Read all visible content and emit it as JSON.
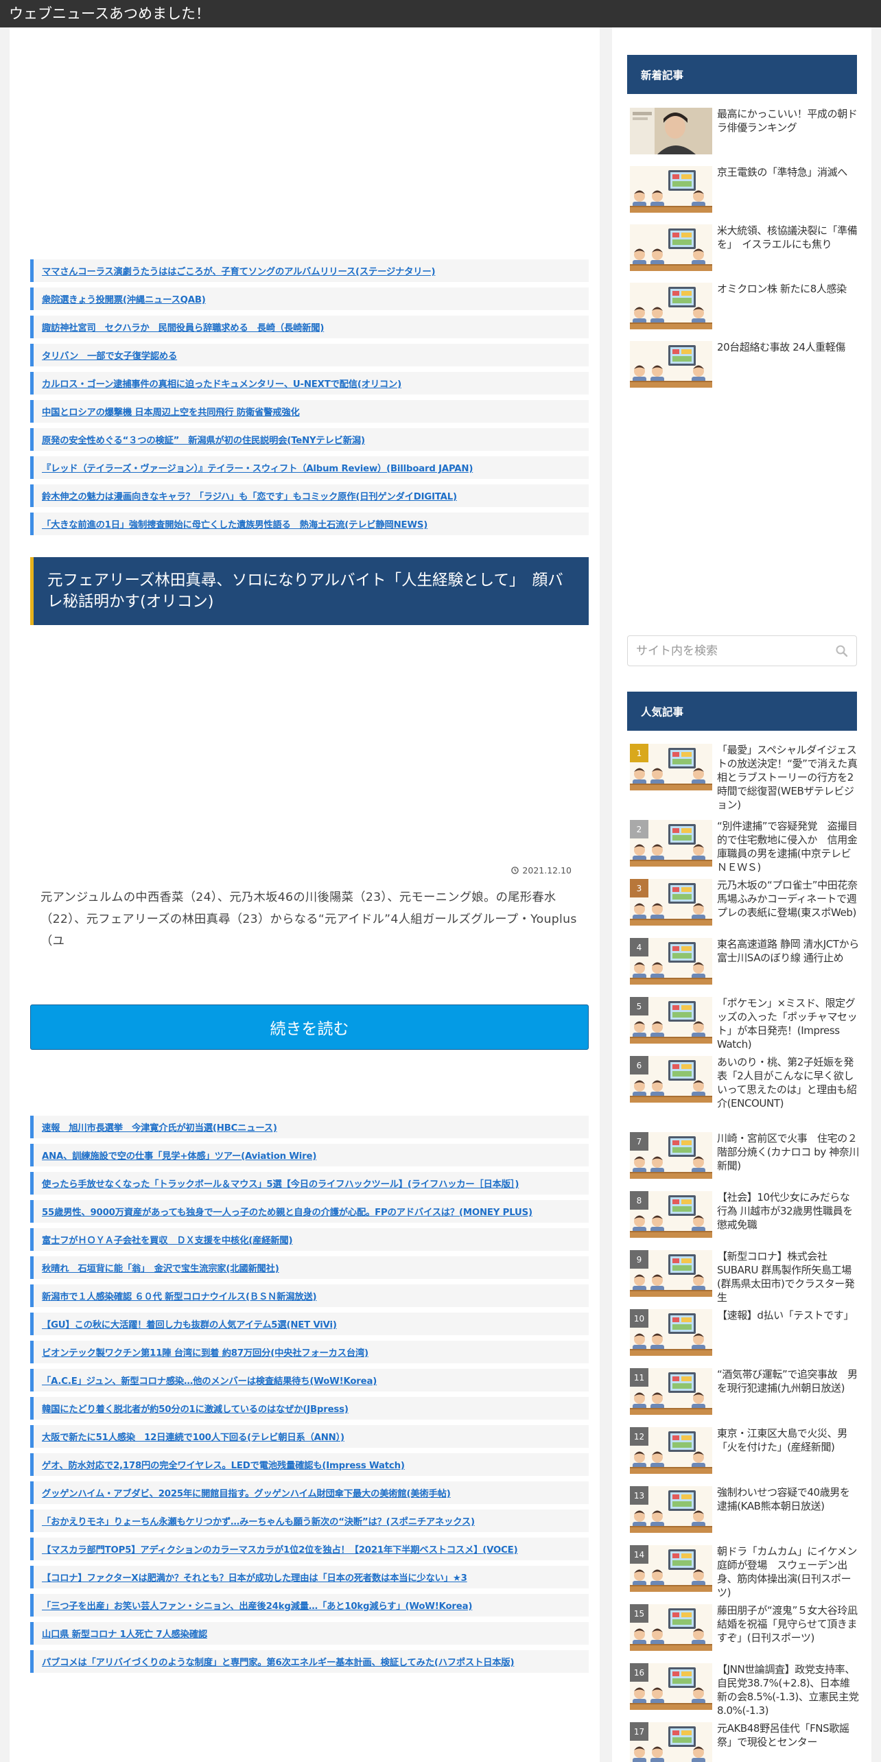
{
  "site": {
    "title": "ウェブニュースあつめました！"
  },
  "top_links": [
    "ママさんコーラス演劇うたうははごころが、子育てソングのアルバムリリース(ステージナタリー)",
    "衆院選きょう投開票(沖縄ニュースQAB)",
    "諏訪神社宮司　セクハラか　民間役員ら辞職求める　長崎（長崎新聞)",
    "タリバン　一部で女子復学認める",
    "カルロス・ゴーン逮捕事件の真相に迫ったドキュメンタリー、U-NEXTで配信(オリコン)",
    "中国とロシアの爆撃機 日本周辺上空を共同飛行 防衛省警戒強化",
    "原発の安全性めぐる“３つの検証”　新潟県が初の住民説明会(TeNYテレビ新潟)",
    "『レッド（テイラーズ・ヴァージョン）』テイラー・スウィフト（Album Review）(Billboard JAPAN)",
    "鈴木伸之の魅力は漫画向きなキャラ？「ラジハ」も「恋です」もコミック原作(日刊ゲンダイDIGITAL)",
    "「大きな前進の1日」強制捜査開始に母亡くした遺族男性語る　熱海土石流(テレビ静岡NEWS)"
  ],
  "article": {
    "title": "元フェアリーズ林田真尋、ソロになりアルバイト「人生経験として」　顔バレ秘話明かす(オリコン)",
    "date": "2021.12.10",
    "excerpt": "元アンジュルムの中西香菜（24）、元乃木坂46の川後陽菜（23）、元モーニング娘。の尾形春水（22）、元フェアリーズの林田真尋（23）からなる“元アイドル”4人組ガールズグループ・Youplus（ユ",
    "read_more": "続きを読む"
  },
  "bottom_links": [
    "速報　旭川市長選挙　今津寛介氏が初当選(HBCニュース)",
    "ANA、訓練施設で空の仕事「見学+体感」ツアー(Aviation Wire)",
    "使ったら手放せなくなった「トラックボール＆マウス」5選【今日のライフハックツール】(ライフハッカー［日本版］)",
    "55歳男性、9000万資産があっても独身で一人っ子のため親と自身の介護が心配。FPのアドバイスは？(MONEY PLUS)",
    "富士フがＨＯＹＡ子会社を買収　ＤＸ支援を中核化(産経新聞)",
    "秋晴れ　石垣背に能「翁」　金沢で宝生流宗家(北國新聞社)",
    "新潟市で１人感染確認 ６０代 新型コロナウイルス(ＢＳＮ新潟放送)",
    "【GU】この秋に大活躍！着回し力も抜群の人気アイテム5選(NET ViVi)",
    "ビオンテック製ワクチン第11陣 台湾に到着 約87万回分(中央社フォーカス台湾)",
    "「A.C.E」ジュン、新型コロナ感染…他のメンバーは検査結果待ち(WoW!Korea)",
    "韓国にたどり着く脱北者が約50分の1に激減しているのはなぜか(JBpress)",
    "大阪で新たに51人感染　12日連続で100人下回る(テレビ朝日系（ANN）)",
    "ゲオ、防水対応で2,178円の完全ワイヤレス。LEDで電池残量確認も(Impress Watch)",
    "グッゲンハイム・アブダビ、2025年に開館目指す。グッゲンハイム財団傘下最大の美術館(美術手帖)",
    "「おかえりモネ」りょーちん永瀬もケリつかず…みーちゃんも願う新次の“決断”は？(スポニチアネックス)",
    "【マスカラ部門TOP5】アディクションのカラーマスカラが1位2位を独占！【2021年下半期ベストコスメ】(VOCE)",
    "【コロナ】ファクターXは肥満か？それとも？日本が成功した理由は「日本の死者数は本当に少ない」★3",
    "「三つ子を出産」お笑い芸人ファン・シニョン、出産後24kg減量…「あと10kg減らす」(WoW!Korea)",
    "山口県 新型コロナ 1人死亡 7人感染確認",
    "パブコメは「アリバイづくりのような制度」と専門家。第6次エネルギー基本計画、検証してみた(ハフポスト日本版)"
  ],
  "sidebar": {
    "new_heading": "新着記事",
    "new_articles": [
      "最高にかっこいい！平成の朝ドラ俳優ランキング",
      "京王電鉄の「準特急」消滅へ",
      "米大統領、核協議決裂に「準備を」　イスラエルにも焦り",
      "オミクロン株 新たに8人感染",
      "20台超絡む事故 24人重軽傷"
    ],
    "search_placeholder": "サイト内を検索",
    "popular_heading": "人気記事",
    "popular": [
      {
        "rank": "1",
        "title": "「最愛」スペシャルダイジェストの放送決定！“愛”で消えた真相とラブストーリーの行方を2時間で総復習(WEBザテレビジョン)"
      },
      {
        "rank": "2",
        "title": "“別件逮捕”で容疑発覚　盗撮目的で住宅敷地に侵入か　信用金庫職員の男を逮捕(中京テレビＮＥＷＳ)"
      },
      {
        "rank": "3",
        "title": "元乃木坂の“プロ雀士”中田花奈　馬場ふみかコーディネートで週プレの表紙に登場(東スポWeb)"
      },
      {
        "rank": "4",
        "title": "東名高速道路 静岡 清水JCTから富士川SAのぼり線 通行止め"
      },
      {
        "rank": "5",
        "title": "「ポケモン」×ミスド、限定グッズの入った「ポッチャマセット」が本日発売！(Impress Watch)"
      },
      {
        "rank": "6",
        "title": "あいのり・桃、第2子妊娠を発表「2人目がこんなに早く欲しいって思えたのは」と理由も紹介(ENCOUNT)"
      },
      {
        "rank": "7",
        "title": "川崎・宮前区で火事　住宅の２階部分焼く(カナロコ by 神奈川新聞)"
      },
      {
        "rank": "8",
        "title": "【社会】10代少女にみだらな行為 川越市が32歳男性職員を懲戒免職"
      },
      {
        "rank": "9",
        "title": "【新型コロナ】株式会社SUBARU 群馬製作所矢島工場(群馬県太田市)でクラスター発生"
      },
      {
        "rank": "10",
        "title": "【速報】d払い「テストです」"
      },
      {
        "rank": "11",
        "title": "“酒気帯び運転”で追突事故　男を現行犯逮捕(九州朝日放送)"
      },
      {
        "rank": "12",
        "title": "東京・江東区大島で火災、男「火を付けた」(産経新聞)"
      },
      {
        "rank": "13",
        "title": "強制わいせつ容疑で40歳男を逮捕(KAB熊本朝日放送)"
      },
      {
        "rank": "14",
        "title": "朝ドラ「カムカム」にイケメン庭師が登場　スウェーデン出身、筋肉体操出演(日刊スポーツ)"
      },
      {
        "rank": "15",
        "title": "藤田朋子が“渡鬼”５女大谷玲凪結婚を祝福「見守らせて頂きますぞ」(日刊スポーツ)"
      },
      {
        "rank": "16",
        "title": "【JNN世論調査】政党支持率、自民党38.7%(+2.8)、日本維新の会8.5%(-1.3)、立憲民主党8.0%(-1.3)"
      },
      {
        "rank": "17",
        "title": "元AKB48野呂佳代「FNS歌謡祭」で現役とセンター"
      }
    ]
  },
  "colors": {
    "topbar": "#333333",
    "heading_blue": "#214978",
    "link_blue": "#1e6fc8",
    "accent_bar": "#3d8de6",
    "title_accent": "#e7b21c",
    "button_blue": "#049be5",
    "rank_gold": "#d9a81c",
    "rank_silver": "#a9a9a9",
    "rank_bronze": "#b8773a",
    "rank_default": "#6b6b6b"
  }
}
